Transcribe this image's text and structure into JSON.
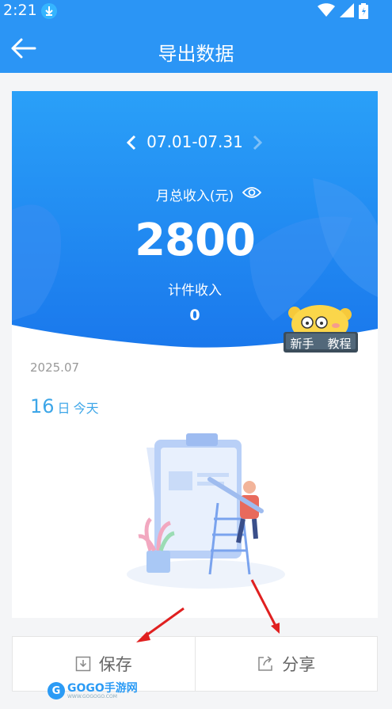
{
  "status_bar": {
    "time": "2:21"
  },
  "header": {
    "title": "导出数据"
  },
  "summary": {
    "period": "07.01-07.31",
    "month_income_label": "月总收入(元)",
    "month_income_value": "2800",
    "piecework_label": "计件收入",
    "piecework_value": "0"
  },
  "guide_badge": {
    "left": "新手",
    "right": "教程"
  },
  "record": {
    "date": "2025.07",
    "day": "16",
    "day_unit": "日",
    "today": "今天"
  },
  "actions": {
    "save": "保存",
    "share": "分享"
  },
  "watermark": {
    "brand": "GOGO手游网",
    "url": "WWW.GOGOGO.COM"
  },
  "colors": {
    "header": "#2b95f5",
    "hero_top": "#2a9cf7",
    "accent": "#3da6e8",
    "arrow": "#e02020"
  },
  "icons": [
    "back-arrow-icon",
    "download-icon",
    "wifi-icon",
    "signal-icon",
    "battery-icon",
    "chevron-left-icon",
    "chevron-right-icon",
    "eye-icon",
    "save-icon",
    "share-icon"
  ]
}
